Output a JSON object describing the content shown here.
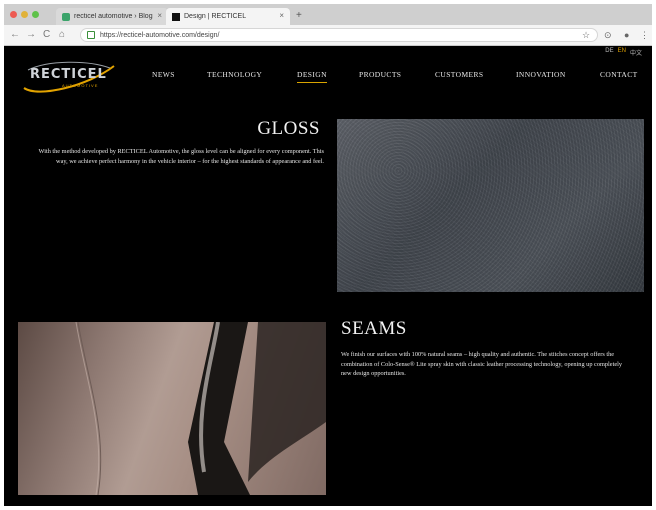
{
  "browser": {
    "tabs": [
      {
        "title": "recticel automotive › Blog",
        "close": "×"
      },
      {
        "title": "Design | RECTICEL",
        "close": "×"
      }
    ],
    "new_tab": "+",
    "address": "https://recticel-automotive.com/design/",
    "nav": {
      "back": "←",
      "forward": "→",
      "reload": "C",
      "home": "⌂"
    }
  },
  "site": {
    "languages": [
      "DE",
      "EN",
      "中文"
    ],
    "logo": {
      "name": "RECTICEL",
      "sub": "AUTOMOTIVE"
    },
    "nav": [
      {
        "label": "NEWS"
      },
      {
        "label": "TECHNOLOGY"
      },
      {
        "label": "DESIGN"
      },
      {
        "label": "PRODUCTS"
      },
      {
        "label": "CUSTOMERS"
      },
      {
        "label": "INNOVATION"
      },
      {
        "label": "CONTACT"
      }
    ],
    "gloss": {
      "heading": "GLOSS",
      "text": "With the method developed by RECTICEL Automotive, the gloss level can be aligned for every component. This way, we achieve perfect harmony in the vehicle interior – for the highest standards of appearance and feel."
    },
    "seams": {
      "heading": "SEAMS",
      "text": "We finish our surfaces with 100% natural seams – high quality and authentic. The stitches concept offers the combination of Colo-Sense® Lite spray skin with classic leather processing technology, opening up completely new design opportunities."
    }
  },
  "colors": {
    "accent": "#d9a400",
    "background": "#000000"
  }
}
